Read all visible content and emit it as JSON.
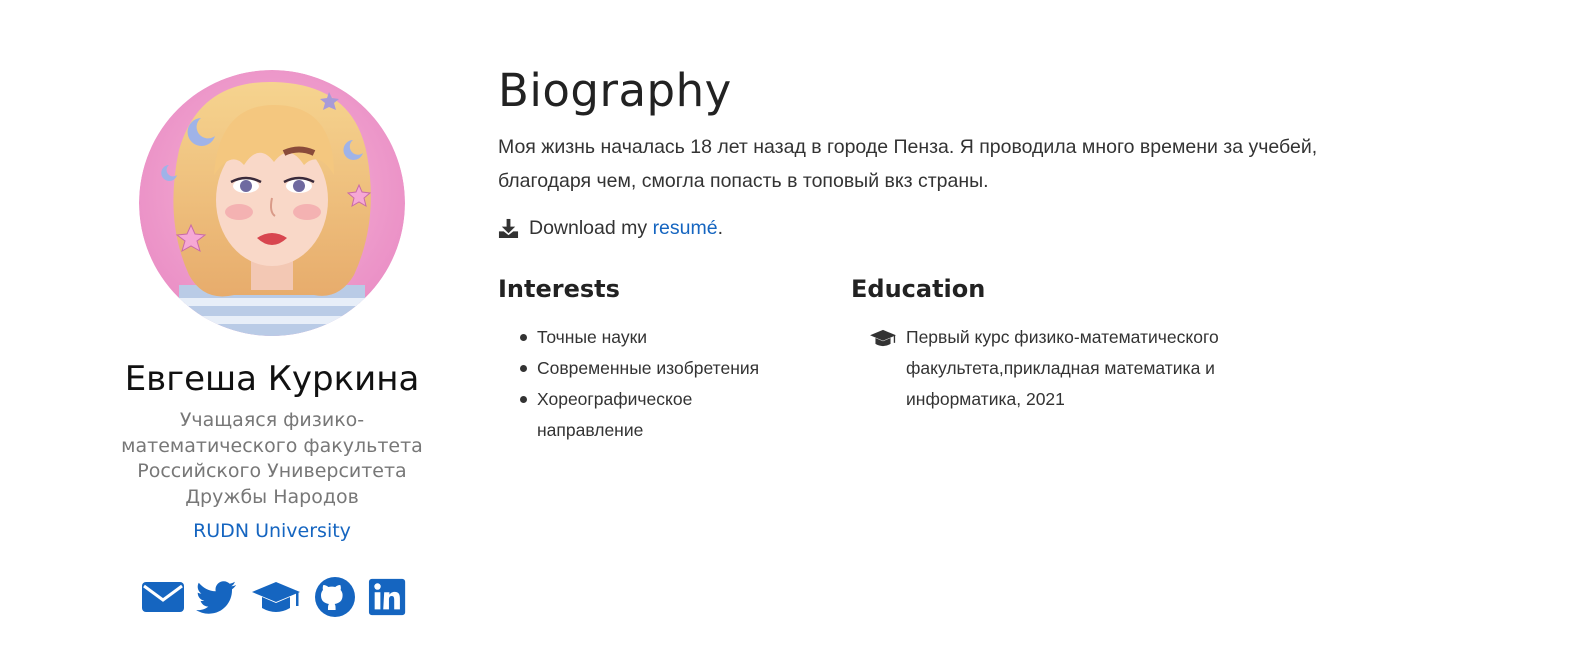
{
  "profile": {
    "avatar_alt": "avatar",
    "name": "Евгеша Куркина",
    "role": "Учащаяся физико-математического факультета Российского Университета Дружбы Народов",
    "organization": "RUDN University",
    "social": [
      {
        "icon": "envelope-icon"
      },
      {
        "icon": "twitter-icon"
      },
      {
        "icon": "graduation-cap-icon"
      },
      {
        "icon": "github-icon"
      },
      {
        "icon": "linkedin-icon"
      }
    ]
  },
  "biography": {
    "title": "Biography",
    "text": "Моя жизнь началась 18 лет назад в городе Пенза. Я проводила много времени за учебей, благодаря чем, смогла попасть в топовый вкз страны.",
    "download_prefix": "Download my ",
    "download_link": "resumé",
    "download_suffix": "."
  },
  "interests": {
    "title": "Interests",
    "items": [
      "Точные науки",
      "Современные изобретения",
      "Хореографическое направление"
    ]
  },
  "education": {
    "title": "Education",
    "items": [
      {
        "text": "Первый курс физико-математического факультета,прикладная математика и информатика, 2021"
      }
    ]
  },
  "colors": {
    "accent": "#1565c0",
    "text": "#333333",
    "muted": "#777777"
  }
}
